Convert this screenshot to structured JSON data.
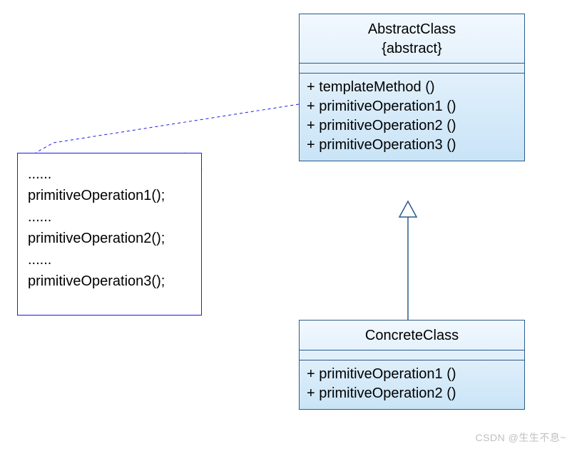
{
  "abstractClass": {
    "name": "AbstractClass",
    "stereotype": "{abstract}",
    "methods": [
      "+  templateMethod ()",
      "+  primitiveOperation1 ()",
      "+  primitiveOperation2 ()",
      "+  primitiveOperation3 ()"
    ]
  },
  "concreteClass": {
    "name": "ConcreteClass",
    "methods": [
      "+  primitiveOperation1 ()",
      "+  primitiveOperation2 ()"
    ]
  },
  "note": {
    "lines": [
      "......",
      "primitiveOperation1();",
      "......",
      "primitiveOperation2();",
      "......",
      "primitiveOperation3();"
    ]
  },
  "watermark": "CSDN @生生不息~"
}
